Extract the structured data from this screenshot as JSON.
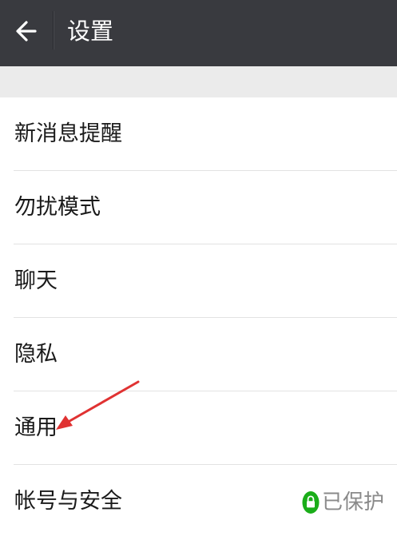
{
  "header": {
    "title": "设置",
    "back_icon": "arrow-left-icon",
    "background": "#393a3f"
  },
  "settings": {
    "items": [
      {
        "label": "新消息提醒"
      },
      {
        "label": "勿扰模式"
      },
      {
        "label": "聊天"
      },
      {
        "label": "隐私"
      },
      {
        "label": "通用"
      },
      {
        "label": "帐号与安全",
        "status": "已保护",
        "status_icon": "lock-icon",
        "status_color": "#1aad19"
      }
    ]
  },
  "annotation": {
    "arrow_color": "#e03232",
    "points_to": "通用"
  }
}
